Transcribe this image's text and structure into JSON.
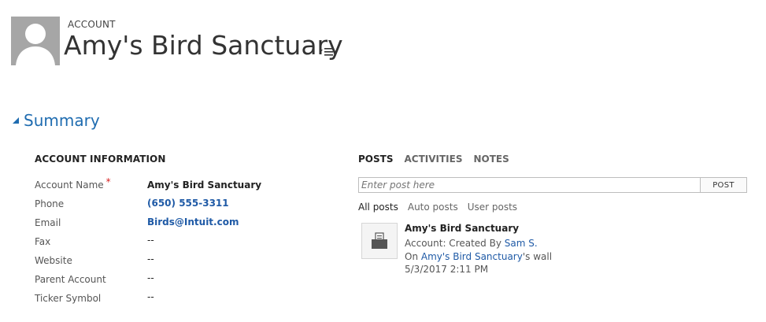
{
  "header": {
    "entity_type": "ACCOUNT",
    "title": "Amy's Bird Sanctuary"
  },
  "summary": {
    "label": "Summary"
  },
  "account_info": {
    "heading": "ACCOUNT INFORMATION",
    "fields": [
      {
        "label": "Account Name",
        "value": "Amy's Bird Sanctuary",
        "required_mark": "*"
      },
      {
        "label": "Phone",
        "value": "(650) 555-3311"
      },
      {
        "label": "Email",
        "value": "Birds@Intuit.com"
      },
      {
        "label": "Fax",
        "value": "--"
      },
      {
        "label": "Website",
        "value": "--"
      },
      {
        "label": "Parent Account",
        "value": "--"
      },
      {
        "label": "Ticker Symbol",
        "value": "--"
      }
    ]
  },
  "social": {
    "tabs": [
      "POSTS",
      "ACTIVITIES",
      "NOTES"
    ],
    "post_placeholder": "Enter post here",
    "post_button": "POST",
    "filters": [
      "All posts",
      "Auto posts",
      "User posts"
    ],
    "post": {
      "title": "Amy's Bird Sanctuary",
      "created_prefix": "Account: Created By ",
      "created_by": "Sam S.",
      "wall_prefix": "On ",
      "wall_link": "Amy's Bird Sanctuary",
      "wall_suffix": "'s wall",
      "timestamp": "5/3/2017 2:11 PM"
    }
  },
  "colors": {
    "accent": "#1f6cb0",
    "link": "#1f5aa6",
    "required": "#d61e1e"
  }
}
